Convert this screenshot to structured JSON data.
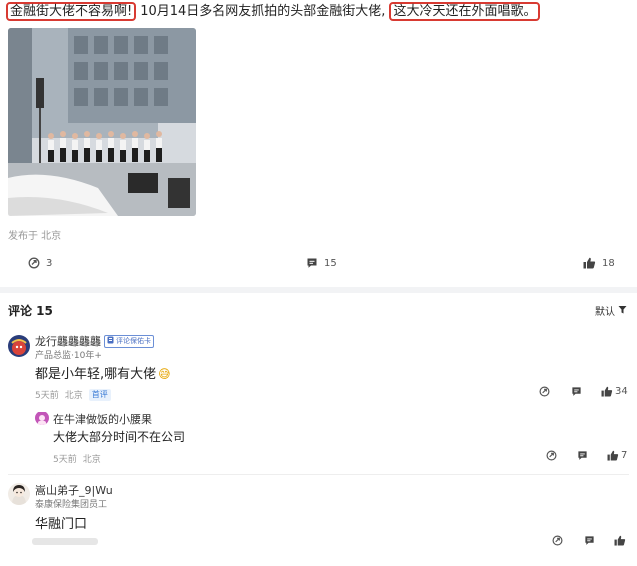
{
  "post": {
    "text_part1": "金融街大佬不容易啊!",
    "text_part2": "10月14日多名网友抓拍的头部金融街大佬,",
    "text_part3": "这大冷天还在外面唱歌。",
    "published": "发布于 北京",
    "actions": {
      "repost_count": "3",
      "comment_count": "15",
      "like_count": "18"
    }
  },
  "comments": {
    "title": "评论 15",
    "sort_label": "默认",
    "items": [
      {
        "name": "龙行龘龘龘龘",
        "badge": "评论保佑卡",
        "title": "产品总监·10年+",
        "text": "都是小年轻,哪有大佬",
        "emoji": "😅",
        "time": "5天前",
        "location": "北京",
        "tag": "首评",
        "like_count": "34",
        "reply": {
          "name": "在牛津做饭的小腰果",
          "text": "大佬大部分时间不在公司",
          "time": "5天前",
          "location": "北京",
          "like_count": "7"
        }
      },
      {
        "name": "嵩山弟子_9|Wu",
        "title": "泰康保险集团员工",
        "text": "华融门口"
      }
    ]
  },
  "colors": {
    "highlight_border": "#d83a32",
    "accent_blue": "#3a7bd5"
  },
  "icons": [
    "repost-icon",
    "comment-icon",
    "like-icon",
    "filter-icon"
  ]
}
